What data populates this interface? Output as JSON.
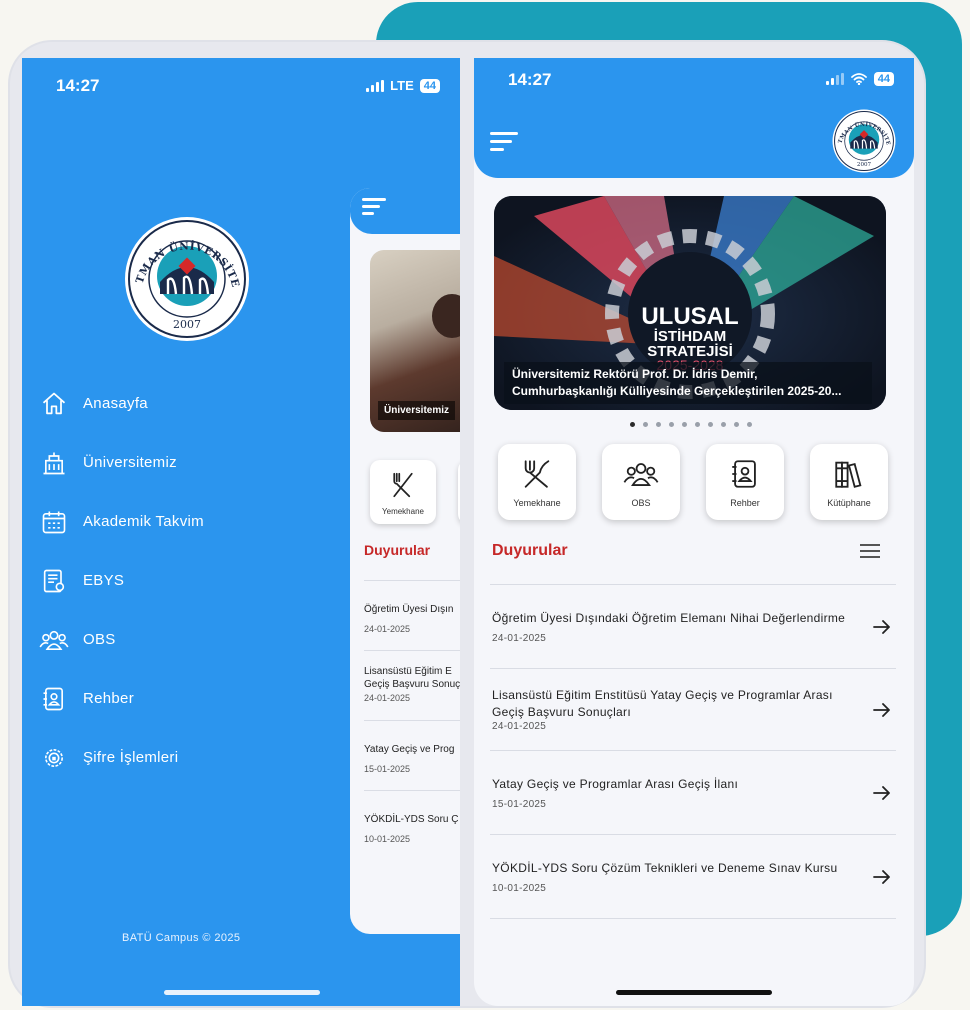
{
  "left_phone": {
    "status": {
      "time": "14:27",
      "network": "LTE",
      "battery": "44"
    },
    "logo": {
      "text": "BATMAN ÜNİVERSİTESİ",
      "year": "2007",
      "icon": "university-seal-icon"
    },
    "drawer_items": [
      {
        "label": "Anasayfa",
        "icon": "home-icon"
      },
      {
        "label": "Üniversitemiz",
        "icon": "building-icon"
      },
      {
        "label": "Akademik Takvim",
        "icon": "calendar-icon"
      },
      {
        "label": "EBYS",
        "icon": "document-icon"
      },
      {
        "label": "OBS",
        "icon": "users-icon"
      },
      {
        "label": "Rehber",
        "icon": "contacts-icon"
      },
      {
        "label": "Şifre İşlemleri",
        "icon": "gear-icon"
      }
    ],
    "footer": "BATÜ Campus © 2025",
    "background_page": {
      "banner_caption": "Üniversitemiz",
      "tile_label": "Yemekhane",
      "section_title": "Duyurular",
      "items": [
        {
          "title": "Öğretim Üyesi Dışın",
          "date": "24-01-2025"
        },
        {
          "title": "Lisansüstü Eğitim E\nGeçiş Başvuru Sonuç",
          "date": "24-01-2025"
        },
        {
          "title": "Yatay Geçiş ve Prog",
          "date": "15-01-2025"
        },
        {
          "title": "YÖKDİL-YDS Soru Ç",
          "date": "10-01-2025"
        }
      ]
    }
  },
  "right_phone": {
    "status": {
      "time": "14:27",
      "battery": "44"
    },
    "logo": {
      "text": "BATMAN ÜNİVERSİTESİ",
      "year": "2007"
    },
    "banner": {
      "image_text_line1": "ULUSAL",
      "image_text_line2": "İSTİHDAM",
      "image_text_line3": "STRATEJİSİ",
      "image_text_line4": "2025-2028",
      "caption": "Üniversitemiz Rektörü Prof. Dr. İdris Demir, Cumhurbaşkanlığı Külliyesinde Gerçekleştirilen 2025-20...",
      "dot_count": 10,
      "active_dot": 0
    },
    "quick_links": [
      {
        "label": "Yemekhane",
        "icon": "fork-knife-icon"
      },
      {
        "label": "OBS",
        "icon": "users-icon"
      },
      {
        "label": "Rehber",
        "icon": "contacts-icon"
      },
      {
        "label": "Kütüphane",
        "icon": "books-icon"
      }
    ],
    "announcements": {
      "title": "Duyurular",
      "items": [
        {
          "title": "Öğretim Üyesi Dışındaki Öğretim Elemanı Nihai Değerlendirme",
          "date": "24-01-2025"
        },
        {
          "title": "Lisansüstü Eğitim Enstitüsü Yatay Geçiş ve Programlar Arası Geçiş Başvuru Sonuçları",
          "date": "24-01-2025"
        },
        {
          "title": "Yatay Geçiş ve Programlar Arası Geçiş İlanı",
          "date": "15-01-2025"
        },
        {
          "title": "YÖKDİL-YDS Soru Çözüm Teknikleri ve Deneme Sınav Kursu",
          "date": "10-01-2025"
        }
      ]
    }
  },
  "colors": {
    "primary_blue": "#2b95ee",
    "accent_teal": "#1aa0b8",
    "announcement_red": "#c62828",
    "page_background": "#f5f6fa"
  }
}
